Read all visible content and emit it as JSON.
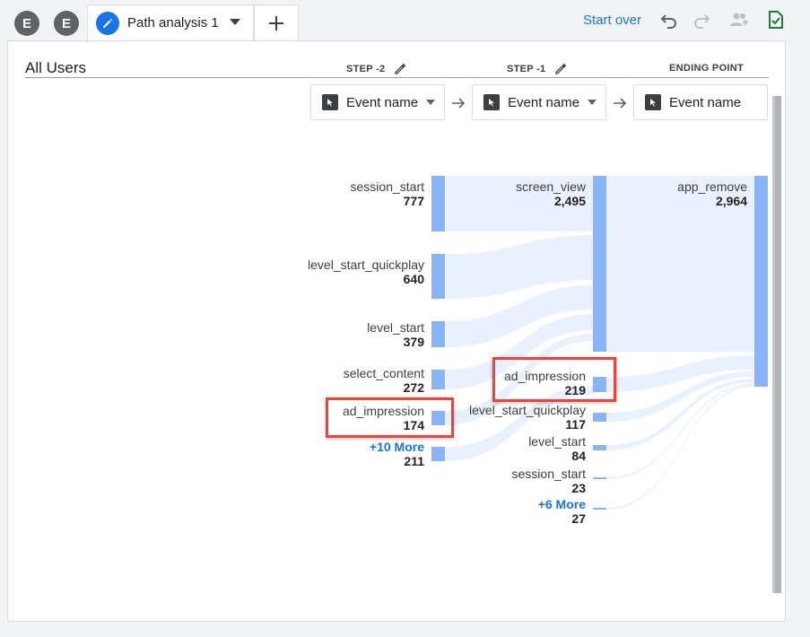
{
  "tabs": {
    "items": [
      {
        "letter": "E"
      },
      {
        "letter": "E"
      }
    ],
    "active_label": "Path analysis 1"
  },
  "toolbar": {
    "start_over": "Start over"
  },
  "segment": {
    "title": "All Users"
  },
  "steps": [
    {
      "header": "STEP -2",
      "dimension": "Event name"
    },
    {
      "header": "STEP -1",
      "dimension": "Event name"
    },
    {
      "header": "ENDING POINT",
      "dimension": "Event name"
    }
  ],
  "step_minus2_nodes": [
    {
      "name": "session_start",
      "value": "777"
    },
    {
      "name": "level_start_quickplay",
      "value": "640"
    },
    {
      "name": "level_start",
      "value": "379"
    },
    {
      "name": "select_content",
      "value": "272"
    },
    {
      "name": "ad_impression",
      "value": "174"
    },
    {
      "name": "+10 More",
      "value": "211"
    }
  ],
  "step_minus1_nodes": [
    {
      "name": "screen_view",
      "value": "2,495"
    },
    {
      "name": "ad_impression",
      "value": "219"
    },
    {
      "name": "level_start_quickplay",
      "value": "117"
    },
    {
      "name": "level_start",
      "value": "84"
    },
    {
      "name": "session_start",
      "value": "23"
    },
    {
      "name": "+6 More",
      "value": "27"
    }
  ],
  "ending_nodes": [
    {
      "name": "app_remove",
      "value": "2,964"
    }
  ],
  "colors": {
    "bar": "#8ab4f8",
    "link": "#e8f0fe",
    "highlight": "#e8453c",
    "accent": "#1a73e8"
  }
}
